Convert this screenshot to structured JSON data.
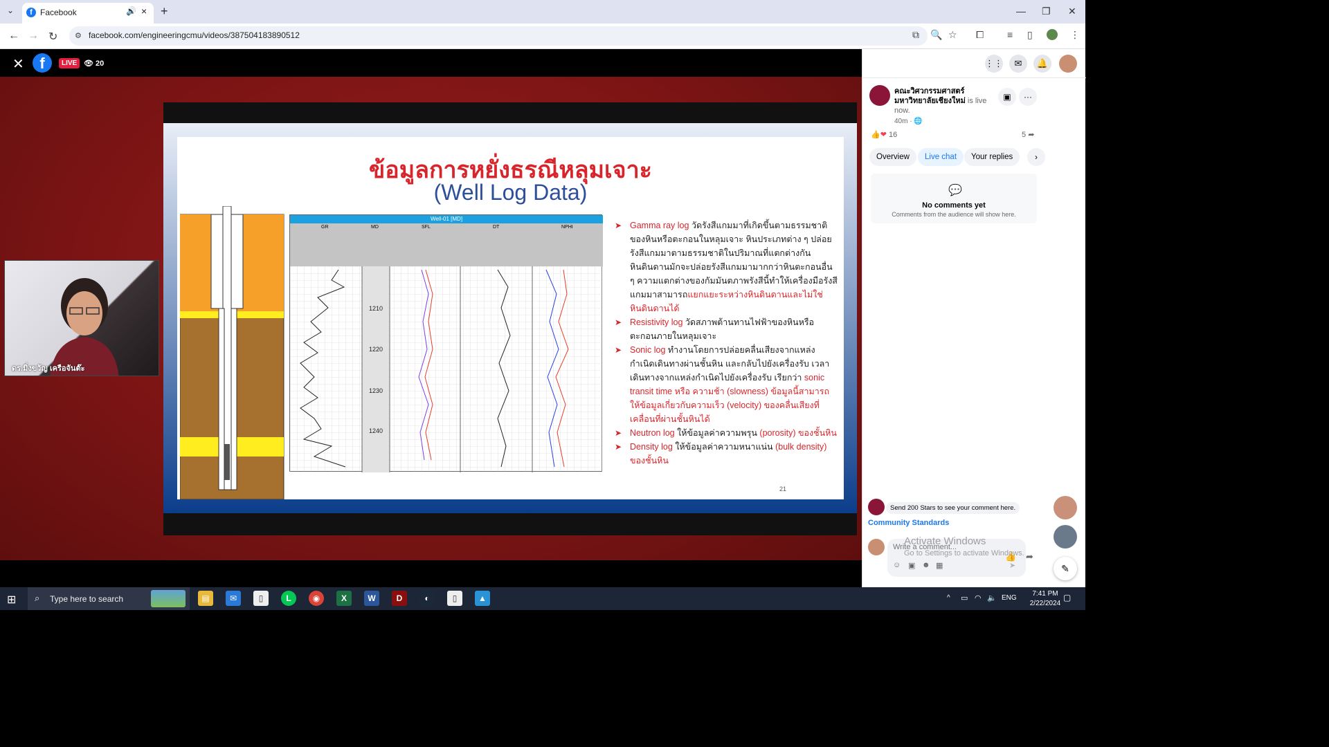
{
  "browser": {
    "tab_title": "Facebook",
    "url": "facebook.com/engineeringcmu/videos/387504183890512"
  },
  "video": {
    "live_label": "LIVE",
    "viewer_count": "20",
    "slide": {
      "title_th": "ข้อมูลการหยั่งธรณีหลุมเจาะ",
      "title_en": "(Well Log Data)",
      "page_number": "21",
      "log_header": "Well-01 [MD]",
      "log_columns": [
        "GR",
        "MD",
        "SFL",
        "DT",
        "NPHI"
      ],
      "log_depths": [
        "1210",
        "1220",
        "1230",
        "1240"
      ],
      "bullets": [
        {
          "term": "Gamma ray log",
          "text": "วัดรังสีแกมมาที่เกิดขึ้นตามธรรมชาติของหินหรือตะกอนในหลุมเจาะ หินประเภทต่าง ๆ ปล่อยรังสีแกมมาตามธรรมชาติในปริมาณที่แตกต่างกัน หินดินดานมักจะปล่อยรังสีแกมมามากกว่าหินตะกอนอื่น ๆ ความแตกต่างของกัมมันตภาพรังสีนี้ทำให้เครื่องมือรังสีแกมมาสามารถ",
          "highlight": "แยกแยะระหว่างหินดินดานและไม่ใช่หินดินดานได้"
        },
        {
          "term": "Resistivity log",
          "text": "วัดสภาพต้านทานไฟฟ้าของหินหรือตะกอนภายในหลุมเจาะ",
          "highlight": ""
        },
        {
          "term": "Sonic log",
          "text": "ทำงานโดยการปล่อยคลื่นเสียงจากแหล่งกำเนิดเดินทางผ่านชั้นหิน และกลับไปยังเครื่องรับ เวลาเดินทางจากแหล่งกำเนิดไปยังเครื่องรับ เรียกว่า",
          "highlight": "sonic transit time หรือ ความช้า (slowness) ข้อมูลนี้สามารถให้ข้อมูลเกี่ยวกับความเร็ว (velocity) ของคลื่นเสียงที่เคลื่อนที่ผ่านชั้นหินได้"
        },
        {
          "term": "Neutron log",
          "text": "ให้ข้อมูลค่าความพรุน",
          "highlight": "(porosity) ของชั้นหิน"
        },
        {
          "term": "Density log",
          "text": "ให้ข้อมูลค่าความหนาแน่น",
          "highlight": "(bulk density) ของชั้นหิน"
        }
      ]
    },
    "presenter_name": "ดร.มิ่งขวัญ เครือจันต๊ะ"
  },
  "panel": {
    "page_name": "คณะวิศวกรรมศาสตร์ มหาวิทยาลัยเชียงใหม่",
    "live_suffix": "is live now.",
    "post_time": "40m ·",
    "reaction_count": "16",
    "share_count": "5",
    "tabs": [
      "Overview",
      "Live chat",
      "Your replies"
    ],
    "no_comments_title": "No comments yet",
    "no_comments_sub": "Comments from the audience will show here.",
    "stars_prompt": "Send 200 Stars to see your comment here.",
    "community_link": "Community Standards",
    "comment_placeholder": "Write a comment..."
  },
  "watermark": {
    "line1": "Activate Windows",
    "line2": "Go to Settings to activate Windows."
  },
  "taskbar": {
    "search_placeholder": "Type here to search",
    "language": "ENG",
    "time": "7:41 PM",
    "date": "2/22/2024"
  },
  "colors": {
    "facebook_blue": "#1877f2",
    "live_red": "#e41e3f",
    "slide_title_red": "#d8252b",
    "slide_title_blue": "#2d4e9a"
  }
}
